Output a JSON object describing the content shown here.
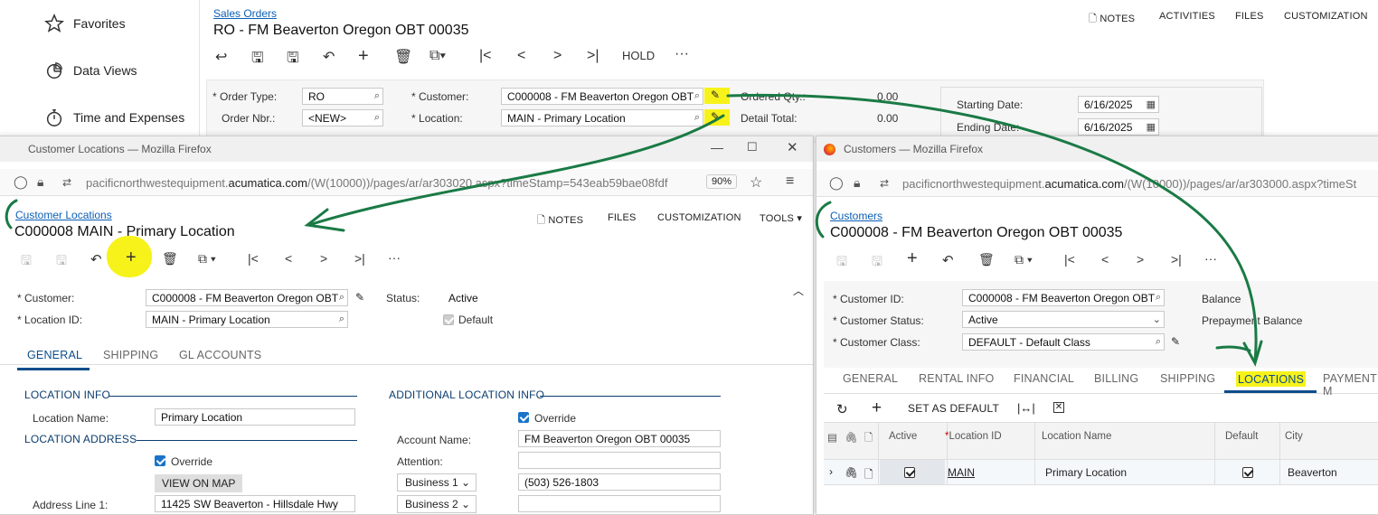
{
  "nav": {
    "items": [
      {
        "label": "Favorites",
        "icon": "star-icon"
      },
      {
        "label": "Data Views",
        "icon": "pie-chart-icon"
      },
      {
        "label": "Time and Expenses",
        "icon": "stopwatch-icon"
      }
    ]
  },
  "main": {
    "breadcrumb": "Sales Orders",
    "title": "RO - FM Beaverton Oregon OBT 00035",
    "top_links": [
      "NOTES",
      "ACTIVITIES",
      "FILES",
      "CUSTOMIZATION"
    ],
    "hold_label": "HOLD",
    "order_type_label": "Order Type:",
    "order_type": "RO",
    "order_nbr_label": "Order Nbr.:",
    "order_nbr": "<NEW>",
    "customer_label": "Customer:",
    "customer": "C000008 - FM Beaverton Oregon OBT",
    "location_label": "Location:",
    "location": "MAIN - Primary Location",
    "ordered_qty_label": "Ordered Qty.:",
    "ordered_qty": "0.00",
    "detail_total_label": "Detail Total:",
    "detail_total": "0.00",
    "starting_date_label": "Starting Date:",
    "starting_date": "6/16/2025",
    "ending_date_label": "Ending Date:",
    "ending_date": "6/16/2025"
  },
  "loc_win": {
    "title": "Customer Locations — Mozilla Firefox",
    "url_pre": "pacificnorthwestequipment.",
    "url_host": "acumatica.com",
    "url_post": "/(W(10000))/pages/ar/ar303020.aspx?timeStamp=543eab59bae08fdf",
    "zoom": "90%",
    "breadcrumb": "Customer Locations",
    "heading": "C000008 MAIN - Primary Location",
    "links": [
      "NOTES",
      "FILES",
      "CUSTOMIZATION",
      "TOOLS"
    ],
    "customer_label": "Customer:",
    "customer": "C000008 - FM Beaverton Oregon OBT",
    "location_id_label": "Location ID:",
    "location_id": "MAIN - Primary Location",
    "status_label": "Status:",
    "status": "Active",
    "default_label": "Default",
    "tabs": [
      "GENERAL",
      "SHIPPING",
      "GL ACCOUNTS"
    ],
    "sec_location_info": "LOCATION INFO",
    "location_name_label": "Location Name:",
    "location_name": "Primary Location",
    "sec_location_address": "LOCATION ADDRESS",
    "override_label": "Override",
    "view_on_map": "VIEW ON MAP",
    "address1_label": "Address Line 1:",
    "address1": "11425 SW Beaverton - Hillsdale Hwy",
    "sec_additional": "ADDITIONAL LOCATION INFO",
    "override2_label": "Override",
    "account_name_label": "Account Name:",
    "account_name": "FM Beaverton Oregon OBT 00035",
    "attention_label": "Attention:",
    "attention": "",
    "business1": "Business 1",
    "phone1": "(503) 526-1803",
    "business2": "Business 2",
    "phone2": ""
  },
  "cust_win": {
    "title": "Customers — Mozilla Firefox",
    "url_pre": "pacificnorthwestequipment.",
    "url_host": "acumatica.com",
    "url_post": "/(W(10000))/pages/ar/ar303000.aspx?timeSt",
    "breadcrumb": "Customers",
    "heading": "C000008 - FM Beaverton Oregon OBT 00035",
    "customer_id_label": "Customer ID:",
    "customer_id": "C000008 - FM Beaverton Oregon OBT",
    "customer_status_label": "Customer Status:",
    "customer_status": "Active",
    "customer_class_label": "Customer Class:",
    "customer_class": "DEFAULT - Default Class",
    "balance_label": "Balance",
    "prepayment_label": "Prepayment Balance",
    "tabs": [
      "GENERAL",
      "RENTAL INFO",
      "FINANCIAL",
      "BILLING",
      "SHIPPING",
      "LOCATIONS",
      "PAYMENT M"
    ],
    "set_default": "SET AS DEFAULT",
    "columns": [
      "Active",
      "Location ID",
      "Location Name",
      "Default",
      "City"
    ],
    "row": {
      "location_id": "MAIN",
      "location_name": "Primary Location",
      "city": "Beaverton"
    }
  },
  "colors": {
    "annotation_green": "#1a7a45",
    "highlight_yellow": "#f7f21a",
    "link_blue": "#0b5fb5"
  }
}
